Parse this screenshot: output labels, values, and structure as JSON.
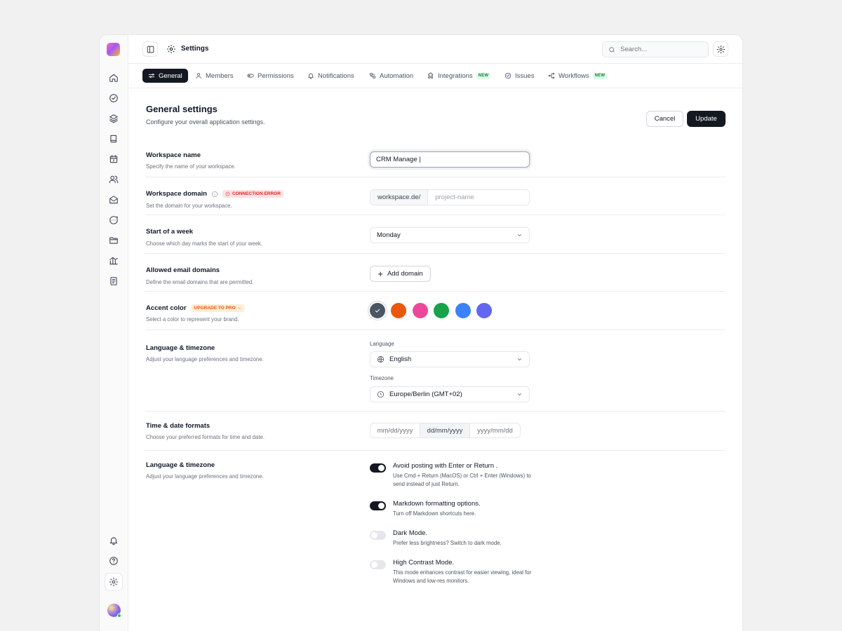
{
  "topbar": {
    "title": "Settings",
    "search_placeholder": "Search..."
  },
  "rail": {
    "icons": [
      "home-icon",
      "check-circle-icon",
      "layers-icon",
      "book-icon",
      "calendar-icon",
      "users-icon",
      "mail-icon",
      "message-icon",
      "folder-icon",
      "chart-icon",
      "document-icon"
    ],
    "bottom_icons": [
      "bell-icon",
      "help-icon",
      "gear-icon"
    ]
  },
  "tabs": [
    {
      "label": "General",
      "active": true
    },
    {
      "label": "Members"
    },
    {
      "label": "Permissions"
    },
    {
      "label": "Notifications"
    },
    {
      "label": "Automation"
    },
    {
      "label": "Integrations",
      "badge": "NEW"
    },
    {
      "label": "Issues"
    },
    {
      "label": "Workflows",
      "badge": "NEW"
    }
  ],
  "header": {
    "title": "General settings",
    "subtitle": "Configure your overall application settings.",
    "cancel": "Cancel",
    "update": "Update"
  },
  "workspace_name": {
    "title": "Workspace name",
    "desc": "Specify the name of your workspace.",
    "value": "CRM Manage |"
  },
  "workspace_domain": {
    "title": "Workspace domain",
    "badge": "CONNECTION ERROR",
    "desc": "Set the domain for your workspace.",
    "prefix": "workspace.de/",
    "placeholder": "project-name"
  },
  "week_start": {
    "title": "Start of a week",
    "desc": "Choose which day marks the start of your week.",
    "value": "Monday"
  },
  "email_domains": {
    "title": "Allowed email domains",
    "desc": "Define the email domains that are permitted.",
    "button": "Add domain"
  },
  "accent": {
    "title": "Accent color",
    "badge": "UPGRADE TO PRO →",
    "desc": "Select a color to represent your brand.",
    "colors": [
      "#4b5563",
      "#ea580c",
      "#ec4899",
      "#16a34a",
      "#3b82f6",
      "#6366f1"
    ],
    "selected": 0
  },
  "language": {
    "title": "Language & timezone",
    "desc": "Adjust your language preferences and timezone.",
    "language_label": "Language",
    "language_value": "English",
    "timezone_label": "Timezone",
    "timezone_value": "Europe/Berlin (GMT+02)"
  },
  "formats": {
    "title": "Time & date formats",
    "desc": "Choose your preferred formats for time and date.",
    "options": [
      "mm/dd/yyyy",
      "dd/mm/yyyy",
      "yyyy/mm/dd"
    ],
    "selected": 1
  },
  "prefs": {
    "title": "Language & timezone",
    "desc": "Adjust your language preferences and timezone.",
    "options": [
      {
        "title": "Avoid posting with Enter or Return .",
        "desc": "Use Cmd + Return (MacOS) or Ctrl + Enter (Windows) to send instead of just Return.",
        "on": true
      },
      {
        "title": "Markdown formatting options.",
        "desc": "Turn off Markdown shortcuts here.",
        "on": true
      },
      {
        "title": "Dark Mode.",
        "desc": "Prefer less brightness? Switch to dark mode.",
        "on": false
      },
      {
        "title": "High Contrast Mode.",
        "desc": "This mode enhances contrast for easier viewing, ideal for Windows and low-res monitors.",
        "on": false
      }
    ]
  }
}
